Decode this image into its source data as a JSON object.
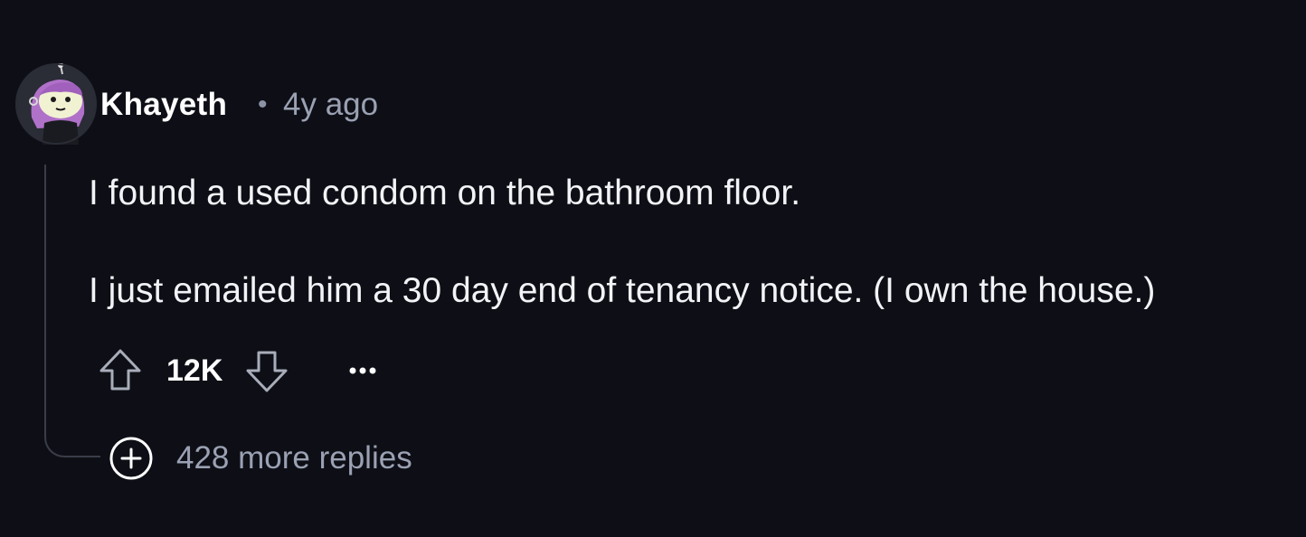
{
  "comment": {
    "author": "Khayeth",
    "separator": "•",
    "age": "4y ago",
    "paragraphs": [
      "I found a used condom on the bathroom floor.",
      "I just emailed him a 30 day end of tenancy notice. (I own the house.)"
    ],
    "score": "12K",
    "replies_label": "428 more replies"
  },
  "icons": {
    "avatar": "avatar",
    "upvote": "upvote-arrow-icon",
    "downvote": "downvote-arrow-icon",
    "more": "more-options-icon",
    "expand": "plus-circle-icon"
  },
  "colors": {
    "background": "#0e0f16",
    "meta_text": "#9aa1b3",
    "thread_line": "#3a3d48",
    "icon_stroke": "#a8adb9"
  }
}
